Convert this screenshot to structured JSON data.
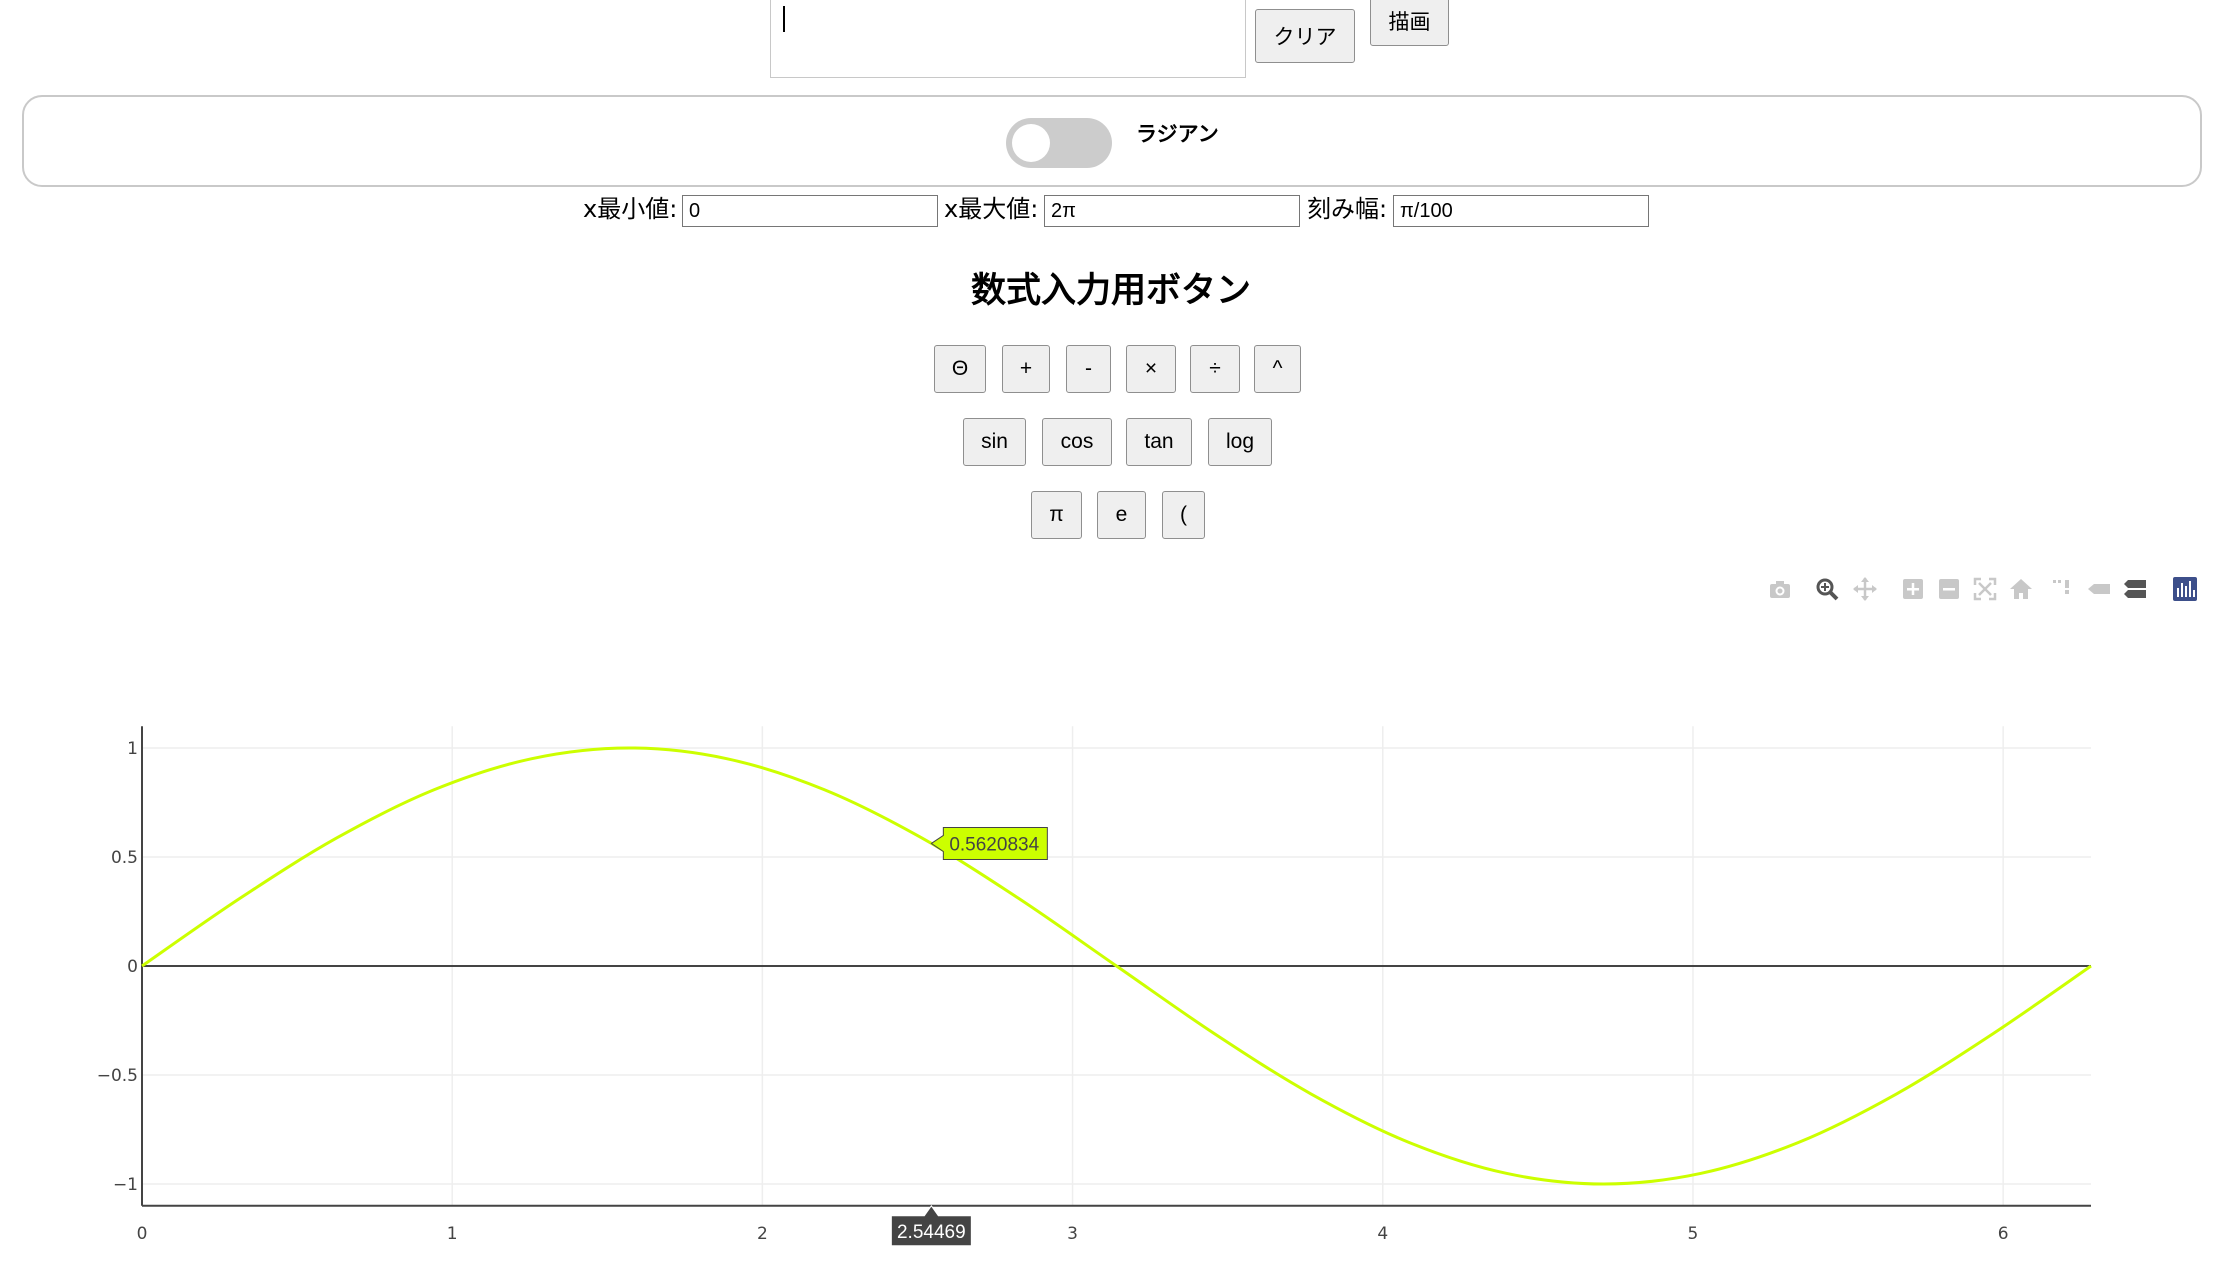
{
  "formula": {
    "value": ""
  },
  "buttons": {
    "clear": "クリア",
    "draw": "描画"
  },
  "toggle": {
    "label": "ラジアン",
    "checked": false
  },
  "range": {
    "xmin_label": "x最小値:",
    "xmin_value": "0",
    "xmax_label": "x最大値:",
    "xmax_value": "2π",
    "step_label": "刻み幅:",
    "step_value": "π/100"
  },
  "keypad": {
    "title": "数式入力用ボタン",
    "row1": [
      "Θ",
      "+",
      "-",
      "×",
      "÷",
      "^"
    ],
    "row2": [
      "sin",
      "cos",
      "tan",
      "log"
    ],
    "row3": [
      "π",
      "e",
      "("
    ]
  },
  "modebar": {
    "icons": [
      "camera-icon",
      "zoom-icon",
      "pan-icon",
      "zoom-in-icon",
      "zoom-out-icon",
      "autoscale-icon",
      "reset-axes-icon",
      "spike-lines-icon",
      "hover-closest-icon",
      "hover-compare-icon",
      "plotly-logo-icon"
    ]
  },
  "colors": {
    "line": "#ccff00",
    "hover_label": "#ccff00",
    "axis_hover": "#444444",
    "grid": "#eeeeee"
  },
  "chart_data": {
    "type": "line",
    "title": "",
    "xlabel": "",
    "ylabel": "",
    "xlim": [
      0,
      6.2832
    ],
    "ylim": [
      -1.1,
      1.1
    ],
    "x_ticks": [
      "0",
      "1",
      "2",
      "3",
      "4",
      "5",
      "6"
    ],
    "y_ticks": [
      "1",
      "0.5",
      "0",
      "−0.5",
      "−1"
    ],
    "series": [
      {
        "function": "sin(x)",
        "x": [
          0,
          0.3142,
          0.6283,
          0.9425,
          1.2566,
          1.5708,
          1.885,
          2.1991,
          2.5133,
          2.8274,
          3.1416,
          3.4558,
          3.7699,
          4.0841,
          4.3982,
          4.7124,
          5.0265,
          5.3407,
          5.6549,
          5.969,
          6.2832
        ],
        "y": [
          0,
          0.309,
          0.5878,
          0.809,
          0.9511,
          1,
          0.9511,
          0.809,
          0.5878,
          0.309,
          0,
          -0.309,
          -0.5878,
          -0.809,
          -0.9511,
          -1,
          -0.9511,
          -0.809,
          -0.5878,
          -0.309,
          0
        ]
      }
    ],
    "hover": {
      "x": 2.54469,
      "x_label": "2.54469",
      "y_label": "0.5620834"
    },
    "grid": true
  }
}
